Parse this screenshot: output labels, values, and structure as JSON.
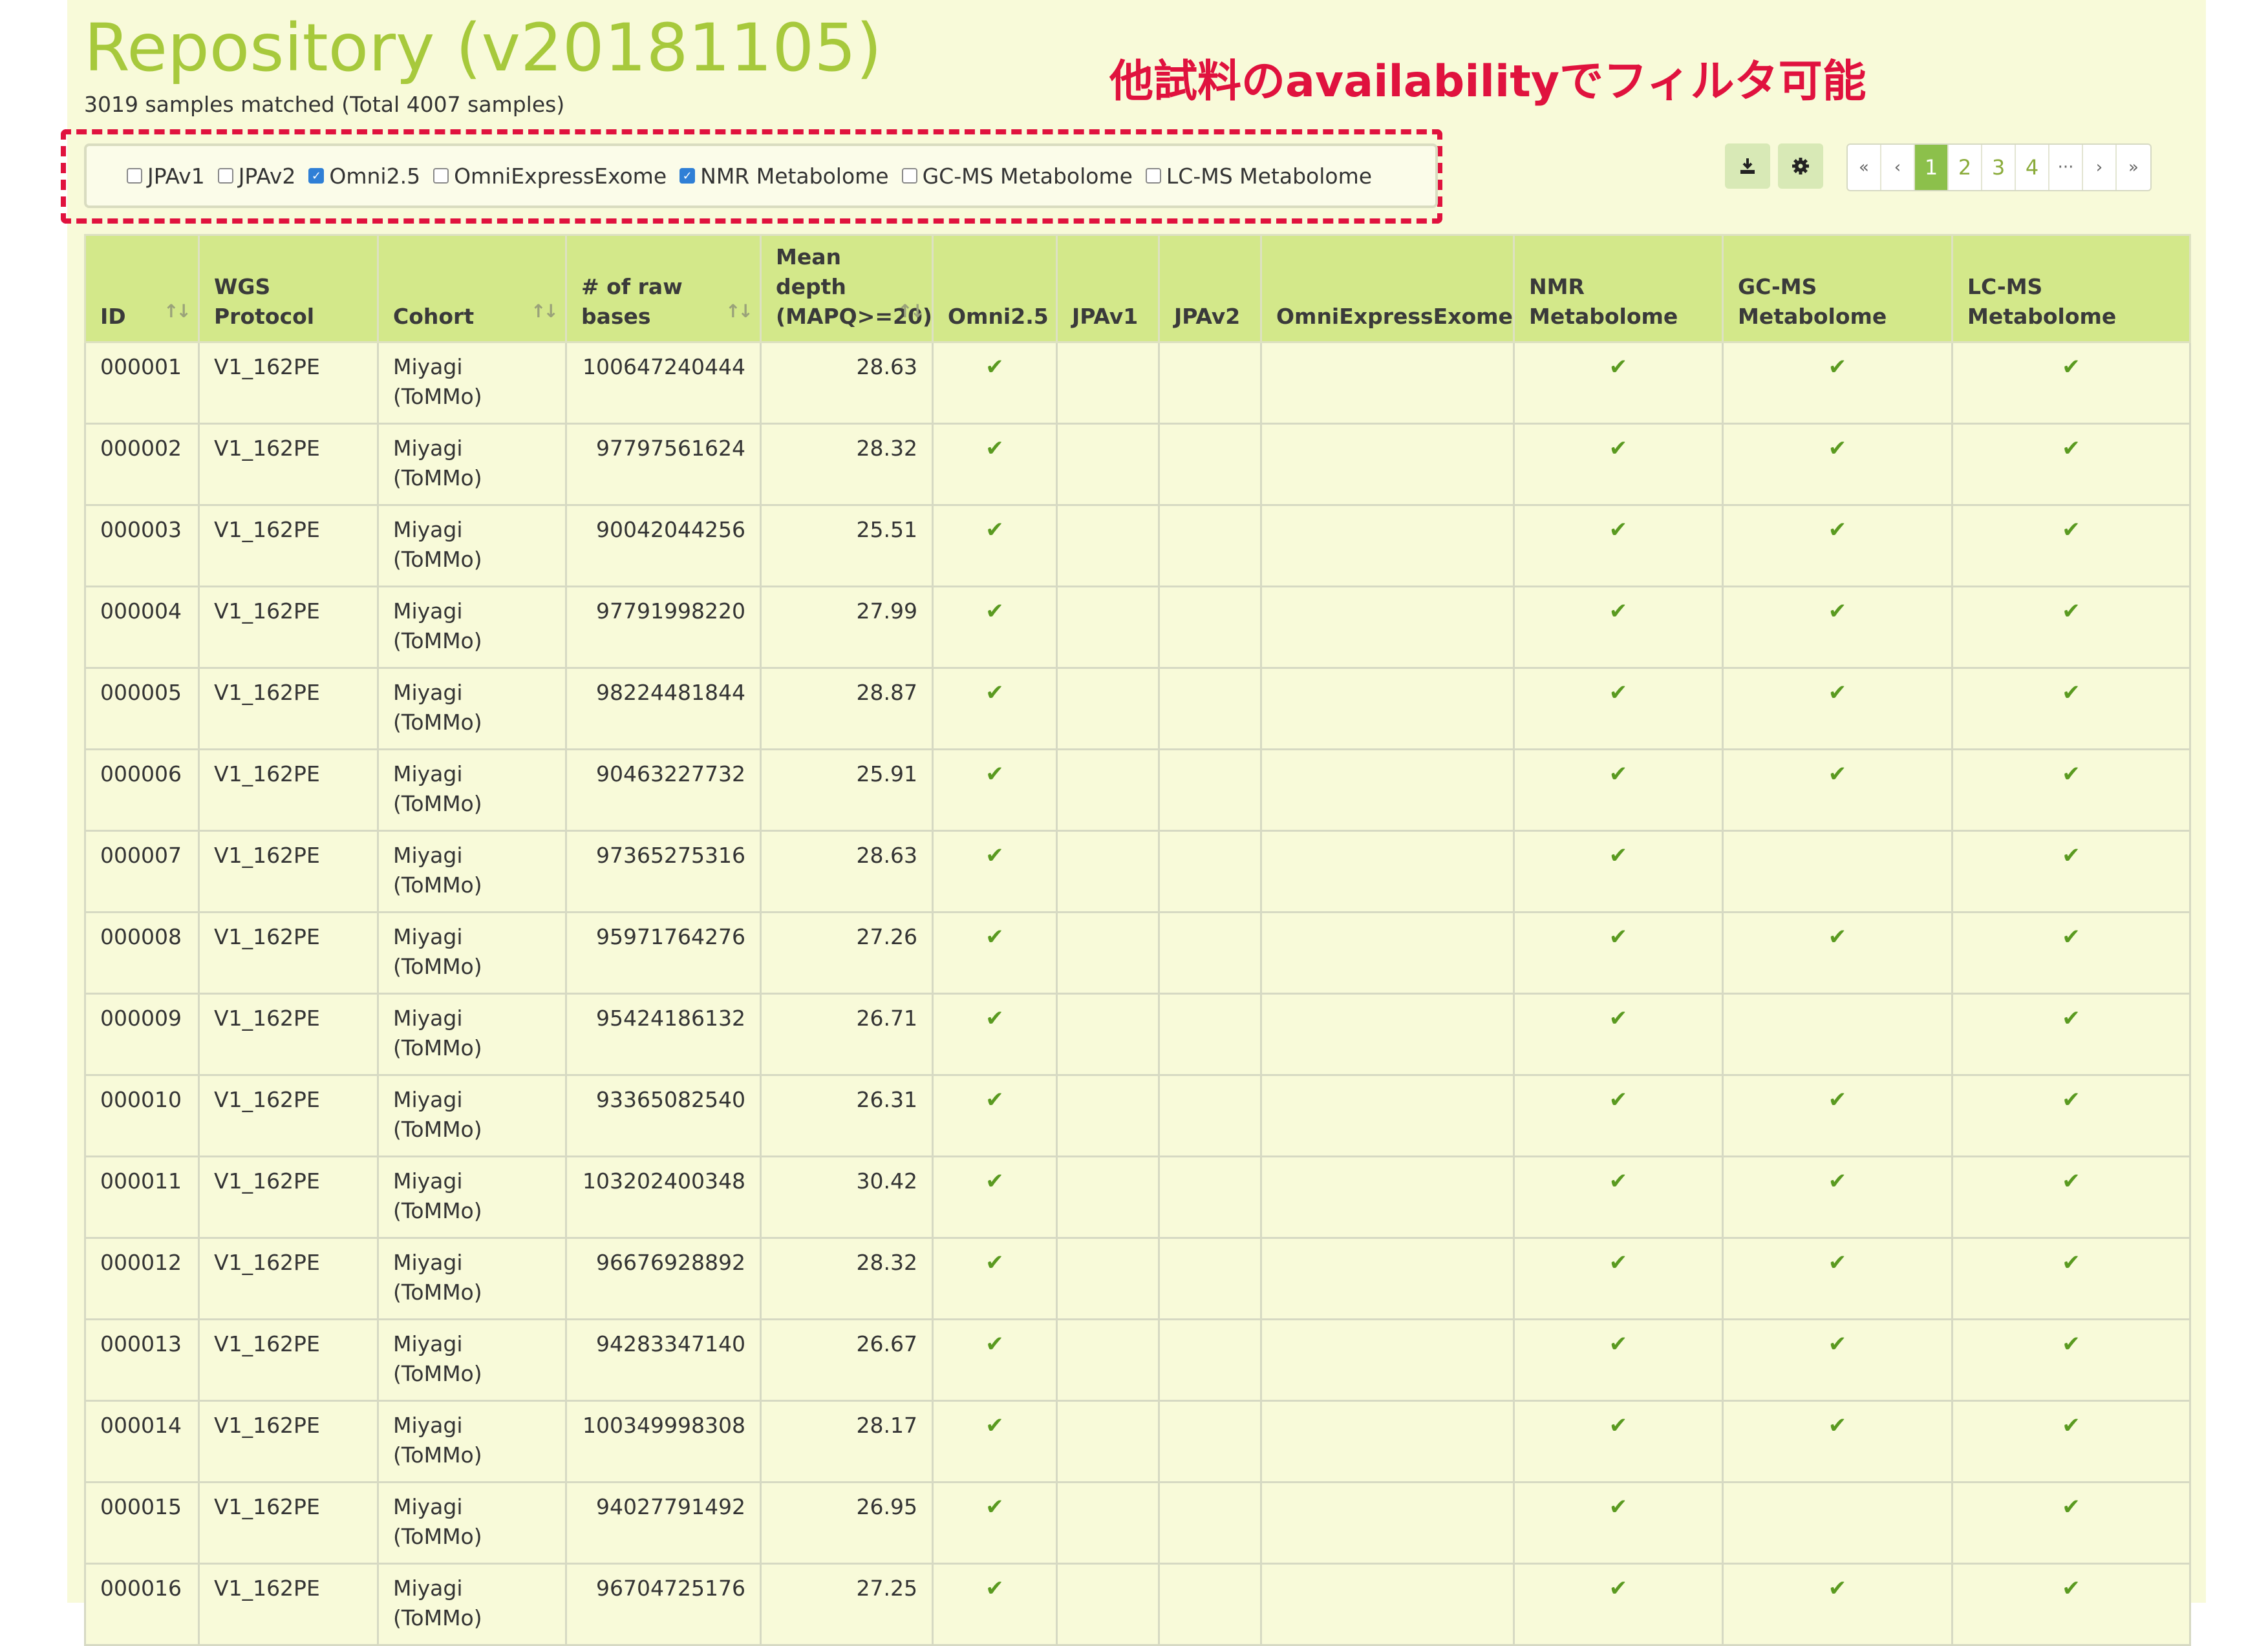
{
  "header": {
    "title": "Repository (v20181105)",
    "subtitle": "3019 samples matched (Total 4007 samples)",
    "annotation": "他試料のavailabilityでフィルタ可能"
  },
  "filters": [
    {
      "label": "JPAv1",
      "checked": false
    },
    {
      "label": "JPAv2",
      "checked": false
    },
    {
      "label": "Omni2.5",
      "checked": true
    },
    {
      "label": "OmniExpressExome",
      "checked": false
    },
    {
      "label": "NMR Metabolome",
      "checked": true
    },
    {
      "label": "GC-MS Metabolome",
      "checked": false
    },
    {
      "label": "LC-MS Metabolome",
      "checked": false
    }
  ],
  "toolbar": {
    "download_icon": "download-icon",
    "settings_icon": "gear-icon"
  },
  "pagination": {
    "first": "«",
    "prev": "‹",
    "pages": [
      "1",
      "2",
      "3",
      "4"
    ],
    "active": "1",
    "ellipsis": "···",
    "next": "›",
    "last": "»"
  },
  "table": {
    "columns": [
      {
        "label": "ID",
        "sortable": true
      },
      {
        "label": "WGS Protocol",
        "sortable": false
      },
      {
        "label": "Cohort",
        "sortable": true
      },
      {
        "label": "# of raw bases",
        "sortable": true
      },
      {
        "label": "Mean depth (MAPQ>=20)",
        "sortable": true
      },
      {
        "label": "Omni2.5",
        "sortable": false
      },
      {
        "label": "JPAv1",
        "sortable": false
      },
      {
        "label": "JPAv2",
        "sortable": false
      },
      {
        "label": "OmniExpressExome",
        "sortable": false
      },
      {
        "label": "NMR Metabolome",
        "sortable": false
      },
      {
        "label": "GC-MS Metabolome",
        "sortable": false
      },
      {
        "label": "LC-MS Metabolome",
        "sortable": false
      }
    ],
    "check_mark": "✔",
    "cohort": "Miyagi (ToMMo)",
    "rows": [
      {
        "id": "000001",
        "protocol": "V1_162PE",
        "bases": "100647240444",
        "depth": "28.63",
        "omni": true,
        "jpav1": false,
        "jpav2": false,
        "oee": false,
        "nmr": true,
        "gcms": true,
        "lcms": true
      },
      {
        "id": "000002",
        "protocol": "V1_162PE",
        "bases": "97797561624",
        "depth": "28.32",
        "omni": true,
        "jpav1": false,
        "jpav2": false,
        "oee": false,
        "nmr": true,
        "gcms": true,
        "lcms": true
      },
      {
        "id": "000003",
        "protocol": "V1_162PE",
        "bases": "90042044256",
        "depth": "25.51",
        "omni": true,
        "jpav1": false,
        "jpav2": false,
        "oee": false,
        "nmr": true,
        "gcms": true,
        "lcms": true
      },
      {
        "id": "000004",
        "protocol": "V1_162PE",
        "bases": "97791998220",
        "depth": "27.99",
        "omni": true,
        "jpav1": false,
        "jpav2": false,
        "oee": false,
        "nmr": true,
        "gcms": true,
        "lcms": true
      },
      {
        "id": "000005",
        "protocol": "V1_162PE",
        "bases": "98224481844",
        "depth": "28.87",
        "omni": true,
        "jpav1": false,
        "jpav2": false,
        "oee": false,
        "nmr": true,
        "gcms": true,
        "lcms": true
      },
      {
        "id": "000006",
        "protocol": "V1_162PE",
        "bases": "90463227732",
        "depth": "25.91",
        "omni": true,
        "jpav1": false,
        "jpav2": false,
        "oee": false,
        "nmr": true,
        "gcms": true,
        "lcms": true
      },
      {
        "id": "000007",
        "protocol": "V1_162PE",
        "bases": "97365275316",
        "depth": "28.63",
        "omni": true,
        "jpav1": false,
        "jpav2": false,
        "oee": false,
        "nmr": true,
        "gcms": false,
        "lcms": true
      },
      {
        "id": "000008",
        "protocol": "V1_162PE",
        "bases": "95971764276",
        "depth": "27.26",
        "omni": true,
        "jpav1": false,
        "jpav2": false,
        "oee": false,
        "nmr": true,
        "gcms": true,
        "lcms": true
      },
      {
        "id": "000009",
        "protocol": "V1_162PE",
        "bases": "95424186132",
        "depth": "26.71",
        "omni": true,
        "jpav1": false,
        "jpav2": false,
        "oee": false,
        "nmr": true,
        "gcms": false,
        "lcms": true
      },
      {
        "id": "000010",
        "protocol": "V1_162PE",
        "bases": "93365082540",
        "depth": "26.31",
        "omni": true,
        "jpav1": false,
        "jpav2": false,
        "oee": false,
        "nmr": true,
        "gcms": true,
        "lcms": true
      },
      {
        "id": "000011",
        "protocol": "V1_162PE",
        "bases": "103202400348",
        "depth": "30.42",
        "omni": true,
        "jpav1": false,
        "jpav2": false,
        "oee": false,
        "nmr": true,
        "gcms": true,
        "lcms": true
      },
      {
        "id": "000012",
        "protocol": "V1_162PE",
        "bases": "96676928892",
        "depth": "28.32",
        "omni": true,
        "jpav1": false,
        "jpav2": false,
        "oee": false,
        "nmr": true,
        "gcms": true,
        "lcms": true
      },
      {
        "id": "000013",
        "protocol": "V1_162PE",
        "bases": "94283347140",
        "depth": "26.67",
        "omni": true,
        "jpav1": false,
        "jpav2": false,
        "oee": false,
        "nmr": true,
        "gcms": true,
        "lcms": true
      },
      {
        "id": "000014",
        "protocol": "V1_162PE",
        "bases": "100349998308",
        "depth": "28.17",
        "omni": true,
        "jpav1": false,
        "jpav2": false,
        "oee": false,
        "nmr": true,
        "gcms": true,
        "lcms": true
      },
      {
        "id": "000015",
        "protocol": "V1_162PE",
        "bases": "94027791492",
        "depth": "26.95",
        "omni": true,
        "jpav1": false,
        "jpav2": false,
        "oee": false,
        "nmr": true,
        "gcms": false,
        "lcms": true
      },
      {
        "id": "000016",
        "protocol": "V1_162PE",
        "bases": "96704725176",
        "depth": "27.25",
        "omni": true,
        "jpav1": false,
        "jpav2": false,
        "oee": false,
        "nmr": true,
        "gcms": true,
        "lcms": true
      }
    ]
  },
  "colors": {
    "title": "#a7c93c",
    "annotation": "#e0123e",
    "header_bg": "#d3e88a",
    "page_bg": "#f8fad9",
    "check": "#5a9a20",
    "active_page": "#8cc04b"
  }
}
